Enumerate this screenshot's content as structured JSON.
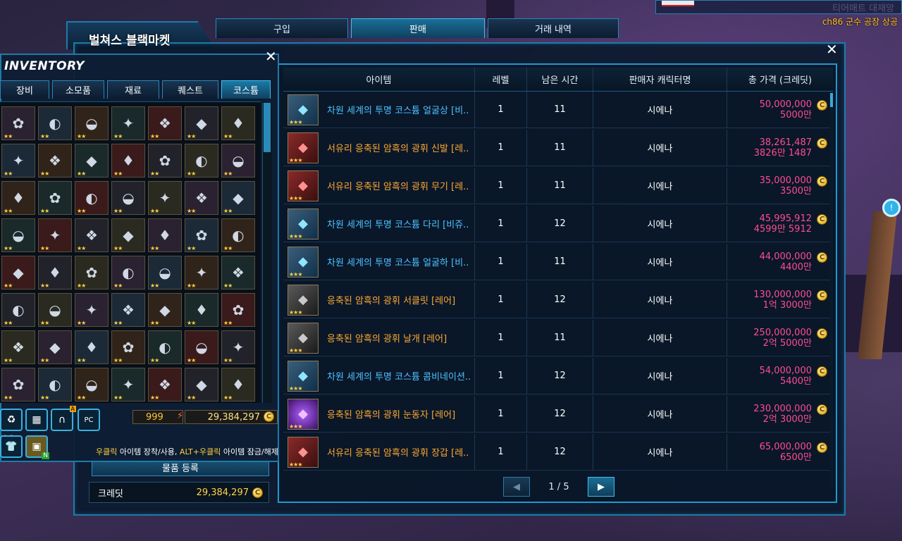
{
  "market": {
    "title": "벌쳐스 블랙마켓",
    "tabs": [
      {
        "label": "구입",
        "active": false
      },
      {
        "label": "판매",
        "active": true
      },
      {
        "label": "거래 내역",
        "active": false
      }
    ],
    "columns": [
      "아이템",
      "레벨",
      "남은 시간",
      "판매자 캐릭터명",
      "총 가격 (크레딧)"
    ],
    "rows": [
      {
        "name": "차원 세계의 투명 코스튬 얼굴상 [비..",
        "color": "blue",
        "icon": "dark-blue",
        "level": "1",
        "time": "11",
        "seller": "시에나",
        "price": "50,000,000",
        "price_short": "5000만"
      },
      {
        "name": "서유리 응축된 암흑의 광휘 신발 [레..",
        "color": "orange",
        "icon": "red",
        "level": "1",
        "time": "11",
        "seller": "시에나",
        "price": "38,261,487",
        "price_short": "3826만 1487"
      },
      {
        "name": "서유리 응축된 암흑의 광휘 무기 [레..",
        "color": "orange",
        "icon": "red",
        "level": "1",
        "time": "11",
        "seller": "시에나",
        "price": "35,000,000",
        "price_short": "3500만"
      },
      {
        "name": "차원 세계의 투명 코스튬 다리 [비쥬..",
        "color": "blue",
        "icon": "dark-blue",
        "level": "1",
        "time": "12",
        "seller": "시에나",
        "price": "45,995,912",
        "price_short": "4599만 5912"
      },
      {
        "name": "차원 세계의 투명 코스튬 얼굴하 [비..",
        "color": "blue",
        "icon": "dark-blue",
        "level": "1",
        "time": "11",
        "seller": "시에나",
        "price": "44,000,000",
        "price_short": "4400만"
      },
      {
        "name": "응축된 암흑의 광휘 서클릿 [레어]",
        "color": "orange",
        "icon": "dark",
        "level": "1",
        "time": "12",
        "seller": "시에나",
        "price": "130,000,000",
        "price_short": "1억 3000만"
      },
      {
        "name": "응축된 암흑의 광휘 날개 [레어]",
        "color": "orange",
        "icon": "dark",
        "level": "1",
        "time": "11",
        "seller": "시에나",
        "price": "250,000,000",
        "price_short": "2억 5000만"
      },
      {
        "name": "차원 세계의 투명 코스튬 콤비네이션..",
        "color": "blue",
        "icon": "dark-blue",
        "level": "1",
        "time": "12",
        "seller": "시에나",
        "price": "54,000,000",
        "price_short": "5400만"
      },
      {
        "name": "응축된 암흑의 광휘 눈동자 [레어]",
        "color": "orange",
        "icon": "purple",
        "level": "1",
        "time": "12",
        "seller": "시에나",
        "price": "230,000,000",
        "price_short": "2억 3000만"
      },
      {
        "name": "서유리 응축된 암흑의 광휘 장갑 [레..",
        "color": "orange",
        "icon": "red",
        "level": "1",
        "time": "12",
        "seller": "시에나",
        "price": "65,000,000",
        "price_short": "6500만"
      }
    ],
    "pager": {
      "text": "1 / 5"
    },
    "register_label": "물품 등록",
    "credit_label": "크레딧",
    "credit_value": "29,384,297"
  },
  "inventory": {
    "title": "INVENTORY",
    "tabs": [
      {
        "label": "장비",
        "active": false
      },
      {
        "label": "소모품",
        "active": false
      },
      {
        "label": "재료",
        "active": false
      },
      {
        "label": "퀘스트",
        "active": false
      },
      {
        "label": "코스튬",
        "active": true
      }
    ],
    "fatigue": "999",
    "credit": "29,384,297",
    "hint_parts": [
      "우클릭",
      " 아이템 장착/사용, ",
      "ALT+우클릭",
      " 아이템 잠금/해제"
    ],
    "button_labels": {
      "delete": "삭제",
      "pc": "PC",
      "badge_a": "A",
      "badge_n": "N"
    }
  },
  "overlay": {
    "channel": "ch86 군수 공장 상공",
    "channel_ghost": "티어매트 대재앙"
  },
  "colors": {
    "accent": "#1d9ad0",
    "price": "#ff4c90",
    "rare_blue": "#4ec2ff",
    "rare_orange": "#ffa930",
    "credit": "#ffd34a"
  }
}
